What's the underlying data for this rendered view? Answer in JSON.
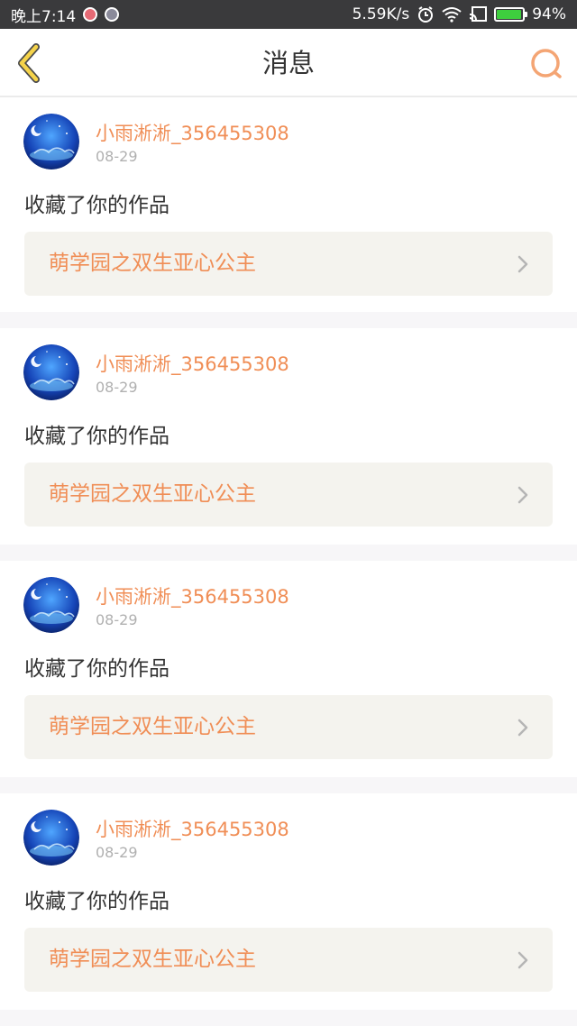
{
  "status_bar": {
    "time": "晚上7:14",
    "speed": "5.59K/s",
    "battery_pct": "94%",
    "battery_level": 0.94,
    "accent_color": "#3ecf3e"
  },
  "header": {
    "title": "消息",
    "back_icon": "chevron-left-icon",
    "search_icon": "search-icon",
    "accent_color": "#f08e56"
  },
  "messages": [
    {
      "username": "小雨淅淅_356455308",
      "date": "08-29",
      "action": "收藏了你的作品",
      "work_title": "萌学园之双生亚心公主"
    },
    {
      "username": "小雨淅淅_356455308",
      "date": "08-29",
      "action": "收藏了你的作品",
      "work_title": "萌学园之双生亚心公主"
    },
    {
      "username": "小雨淅淅_356455308",
      "date": "08-29",
      "action": "收藏了你的作品",
      "work_title": "萌学园之双生亚心公主"
    },
    {
      "username": "小雨淅淅_356455308",
      "date": "08-29",
      "action": "收藏了你的作品",
      "work_title": "萌学园之双生亚心公主"
    }
  ]
}
